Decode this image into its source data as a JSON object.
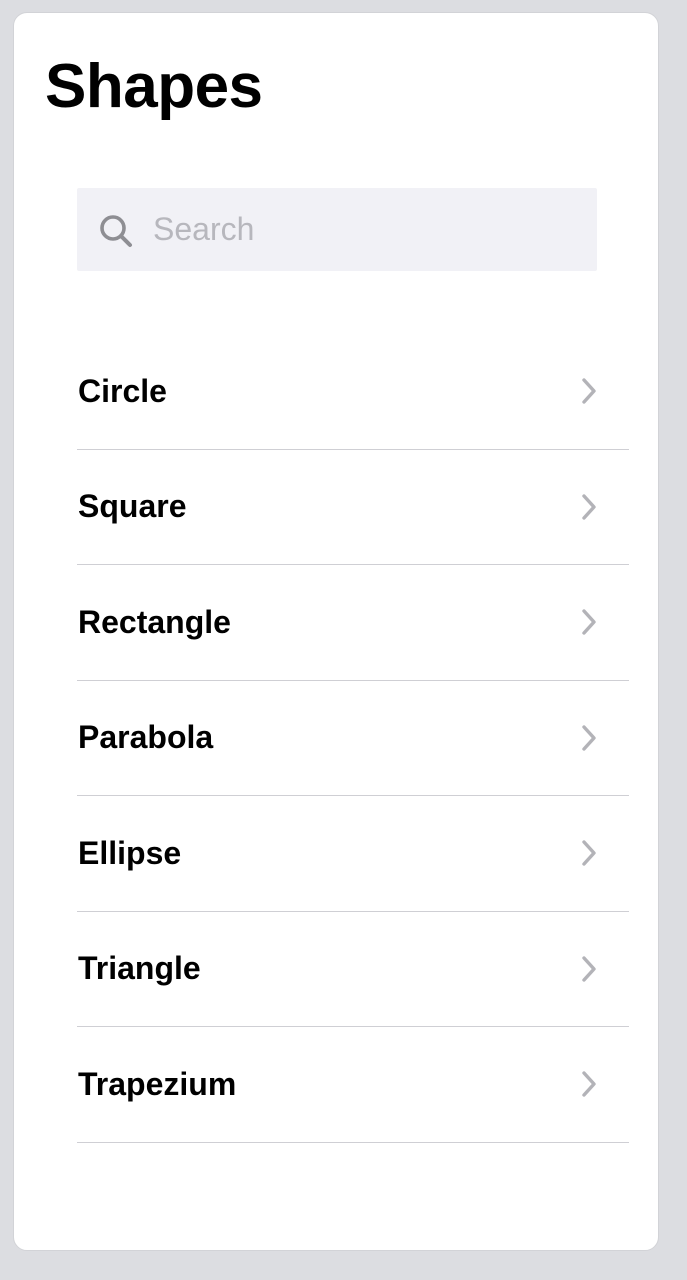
{
  "header": {
    "title": "Shapes"
  },
  "search": {
    "placeholder": "Search",
    "value": "",
    "icon": "search-icon"
  },
  "list": {
    "items": [
      {
        "label": "Circle",
        "icon": "chevron-right-icon"
      },
      {
        "label": "Square",
        "icon": "chevron-right-icon"
      },
      {
        "label": "Rectangle",
        "icon": "chevron-right-icon"
      },
      {
        "label": "Parabola",
        "icon": "chevron-right-icon"
      },
      {
        "label": "Ellipse",
        "icon": "chevron-right-icon"
      },
      {
        "label": "Triangle",
        "icon": "chevron-right-icon"
      },
      {
        "label": "Trapezium",
        "icon": "chevron-right-icon"
      }
    ]
  },
  "colors": {
    "background": "#dcdde1",
    "panel": "#ffffff",
    "search_bg": "#f1f1f6",
    "placeholder": "#b7b7bd",
    "chevron": "#b3b3b8",
    "separator": "#cfcfd4"
  }
}
